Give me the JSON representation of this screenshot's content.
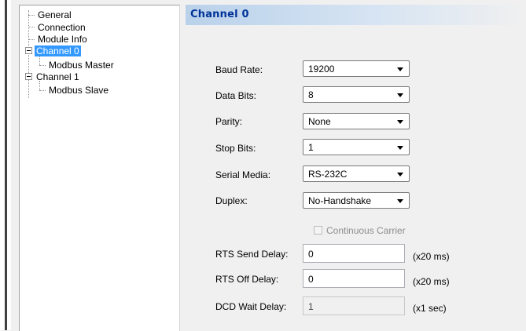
{
  "tree": {
    "items": [
      {
        "label": "General",
        "selected": false
      },
      {
        "label": "Connection",
        "selected": false
      },
      {
        "label": "Module Info",
        "selected": false
      },
      {
        "label": "Channel 0",
        "selected": true
      },
      {
        "label": "Modbus Master",
        "selected": false
      },
      {
        "label": "Channel 1",
        "selected": false
      },
      {
        "label": "Modbus Slave",
        "selected": false
      }
    ]
  },
  "panel": {
    "title": "Channel 0",
    "fields": {
      "baud_rate": {
        "label": "Baud Rate:",
        "value": "19200"
      },
      "data_bits": {
        "label": "Data Bits:",
        "value": "8"
      },
      "parity": {
        "label": "Parity:",
        "value": "None"
      },
      "stop_bits": {
        "label": "Stop Bits:",
        "value": "1"
      },
      "serial_media": {
        "label": "Serial Media:",
        "value": "RS-232C"
      },
      "duplex": {
        "label": "Duplex:",
        "value": "No-Handshake"
      }
    },
    "continuous_carrier": {
      "label": "Continuous Carrier",
      "checked": false,
      "enabled": false
    },
    "rts_send_delay": {
      "label": "RTS Send Delay:",
      "value": "0",
      "unit": "(x20 ms)"
    },
    "rts_off_delay": {
      "label": "RTS Off Delay:",
      "value": "0",
      "unit": "(x20 ms)"
    },
    "dcd_wait_delay": {
      "label": "DCD Wait Delay:",
      "value": "1",
      "unit": "(x1 sec)"
    }
  },
  "colors": {
    "selection": "#3399ff",
    "header_gradient_start": "#b9d1ea",
    "title_text": "#003399"
  }
}
